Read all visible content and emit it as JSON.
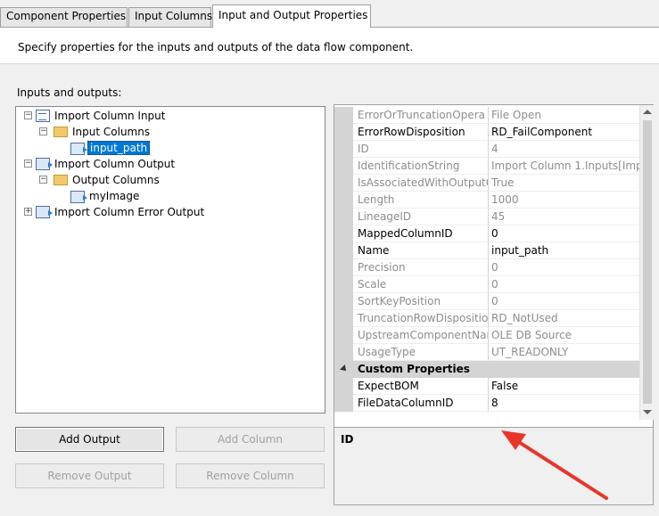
{
  "tabs": [
    {
      "label": "Component Properties",
      "active": false
    },
    {
      "label": "Input Columns",
      "active": false
    },
    {
      "label": "Input and Output Properties",
      "active": true
    }
  ],
  "description": "Specify properties for the inputs and outputs of the data flow component.",
  "io_label": "Inputs and outputs:",
  "tree": {
    "nodes": [
      {
        "label": "Import Column Input",
        "icon": "input-icon",
        "expander": "minus"
      },
      {
        "label": "Input Columns",
        "icon": "folder-icon",
        "expander": "minus"
      },
      {
        "label": "input_path",
        "icon": "column-icon",
        "selected": true
      },
      {
        "label": "Import Column Output",
        "icon": "output-icon",
        "expander": "minus"
      },
      {
        "label": "Output Columns",
        "icon": "folder-icon",
        "expander": "minus"
      },
      {
        "label": "myImage",
        "icon": "column-icon"
      },
      {
        "label": "Import Column Error Output",
        "icon": "output-icon",
        "expander": "plus"
      }
    ]
  },
  "buttons": {
    "add_output": "Add Output",
    "add_column": "Add Column",
    "remove_output": "Remove Output",
    "remove_column": "Remove Column"
  },
  "properties": {
    "rows": [
      {
        "name": "ErrorOrTruncationOpera",
        "value": "File Open",
        "readonly": true
      },
      {
        "name": "ErrorRowDisposition",
        "value": "RD_FailComponent",
        "readonly": false
      },
      {
        "name": "ID",
        "value": "4",
        "readonly": true
      },
      {
        "name": "IdentificationString",
        "value": "Import Column 1.Inputs[Impo",
        "readonly": true
      },
      {
        "name": "IsAssociatedWithOutputC",
        "value": "True",
        "readonly": true
      },
      {
        "name": "Length",
        "value": "1000",
        "readonly": true
      },
      {
        "name": "LineageID",
        "value": "45",
        "readonly": true
      },
      {
        "name": "MappedColumnID",
        "value": "0",
        "readonly": false
      },
      {
        "name": "Name",
        "value": "input_path",
        "readonly": false
      },
      {
        "name": "Precision",
        "value": "0",
        "readonly": true
      },
      {
        "name": "Scale",
        "value": "0",
        "readonly": true
      },
      {
        "name": "SortKeyPosition",
        "value": "0",
        "readonly": true
      },
      {
        "name": "TruncationRowDispositio",
        "value": "RD_NotUsed",
        "readonly": true
      },
      {
        "name": "UpstreamComponentNar",
        "value": "OLE DB Source",
        "readonly": true
      },
      {
        "name": "UsageType",
        "value": "UT_READONLY",
        "readonly": true
      }
    ],
    "category": "Custom Properties",
    "custom_rows": [
      {
        "name": "ExpectBOM",
        "value": "False",
        "readonly": false
      },
      {
        "name": "FileDataColumnID",
        "value": "8",
        "readonly": false
      }
    ]
  },
  "description_pane": {
    "title": "ID"
  },
  "annotation_arrow_color": "#e8352a"
}
